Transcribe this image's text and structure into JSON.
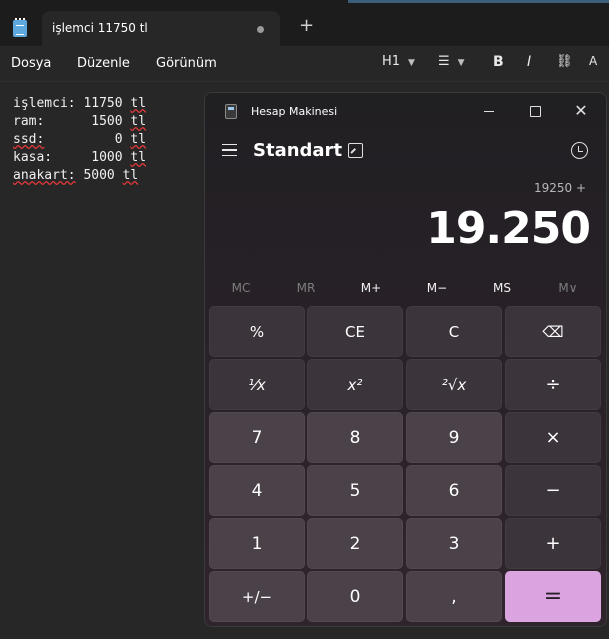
{
  "notepad": {
    "tab_title": "işlemci 11750 tl",
    "new_tab": "+",
    "menu": [
      "Dosya",
      "Düzenle",
      "Görünüm"
    ],
    "toolbar": {
      "heading": "H1",
      "bold": "B",
      "italic": "I",
      "clear_format": "A"
    },
    "lines": [
      {
        "key": "işlemci:",
        "value": "11750",
        "unit": "tl"
      },
      {
        "key": "ram:",
        "value": "1500",
        "unit": "tl"
      },
      {
        "key": "ssd:",
        "value": "0",
        "unit": "tl"
      },
      {
        "key": "kasa:",
        "value": "1000",
        "unit": "tl"
      },
      {
        "key": "anakart:",
        "value": "5000",
        "unit": "tl"
      }
    ]
  },
  "calculator": {
    "window_title": "Hesap Makinesi",
    "mode": "Standart",
    "expression": "19250 +",
    "display": "19.250",
    "memory": [
      "MC",
      "MR",
      "M+",
      "M−",
      "MS",
      "M∨"
    ],
    "keys": [
      [
        "%",
        "CE",
        "C",
        "⌫"
      ],
      [
        "¹⁄x",
        "x²",
        "²√x",
        "÷"
      ],
      [
        "7",
        "8",
        "9",
        "×"
      ],
      [
        "4",
        "5",
        "6",
        "−"
      ],
      [
        "1",
        "2",
        "3",
        "+"
      ],
      [
        "+/−",
        "0",
        ",",
        "="
      ]
    ],
    "accent": "#dba4e0"
  }
}
